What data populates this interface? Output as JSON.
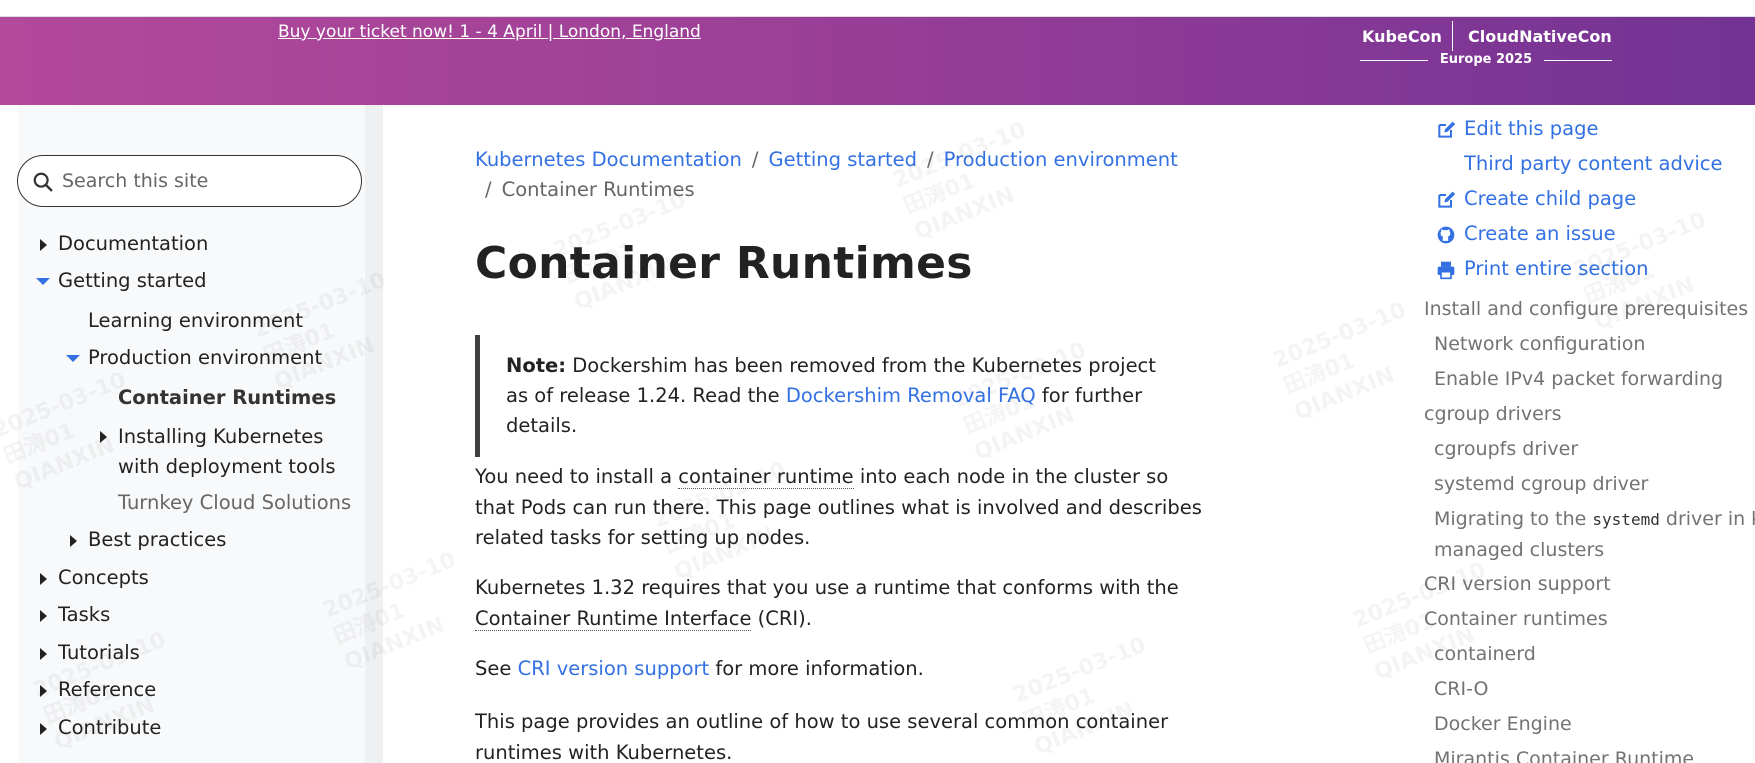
{
  "banner": {
    "link_text": "Buy your ticket now! 1 - 4 April | London, England",
    "logo_left": "KubeCon",
    "logo_right": "CloudNativeCon",
    "logo_sub": "Europe 2025"
  },
  "search": {
    "placeholder": "Search this site"
  },
  "sidebar": {
    "items": [
      {
        "label": "Documentation"
      },
      {
        "label": "Getting started"
      },
      {
        "label": "Learning environment"
      },
      {
        "label": "Production environment"
      },
      {
        "label": "Container Runtimes"
      },
      {
        "label": "Installing Kubernetes"
      },
      {
        "label": "with deployment tools"
      },
      {
        "label": "Turnkey Cloud Solutions"
      },
      {
        "label": "Best practices"
      },
      {
        "label": "Concepts"
      },
      {
        "label": "Tasks"
      },
      {
        "label": "Tutorials"
      },
      {
        "label": "Reference"
      },
      {
        "label": "Contribute"
      }
    ]
  },
  "breadcrumb": {
    "items": [
      "Kubernetes Documentation",
      "Getting started",
      "Production environment",
      "Container Runtimes"
    ],
    "separator": "/"
  },
  "main": {
    "title": "Container Runtimes",
    "note": {
      "label": "Note:",
      "text1": " Dockershim has been removed from the Kubernetes project as of release 1.24. Read the ",
      "link": "Dockershim Removal FAQ",
      "text2": " for further details."
    },
    "p1": {
      "a": "You need to install a ",
      "gloss": "container runtime",
      "b": " into each node in the cluster so that Pods can run there. This page outlines what is involved and describes related tasks for setting up nodes."
    },
    "p2": {
      "a": "Kubernetes 1.32 requires that you use a runtime that conforms with the ",
      "gloss": "Container Runtime Interface",
      "b": " (CRI)."
    },
    "p3": {
      "a": "See ",
      "link": "CRI version support",
      "b": " for more information."
    },
    "p4": "This page provides an outline of how to use several common container runtimes with Kubernetes."
  },
  "page_actions": {
    "edit": "Edit this page",
    "third_party": "Third party content advice",
    "create_child": "Create child page",
    "create_issue": "Create an issue",
    "print": "Print entire section"
  },
  "toc": {
    "items": [
      "Install and configure prerequisites",
      "Network configuration",
      "Enable IPv4 packet forwarding",
      "cgroup drivers",
      "cgroupfs driver",
      "systemd cgroup driver",
      "Migrating to the ",
      "systemd",
      " driver in kubeadm",
      "managed clusters",
      "CRI version support",
      "Container runtimes",
      "containerd",
      "CRI-O",
      "Docker Engine",
      "Mirantis Container Runtime"
    ]
  },
  "watermark": {
    "text": "2025-03-10\n田涛01\nQIANXIN"
  },
  "colors": {
    "link": "#3371e3",
    "banner_start": "#b3499b",
    "banner_end": "#733394"
  }
}
